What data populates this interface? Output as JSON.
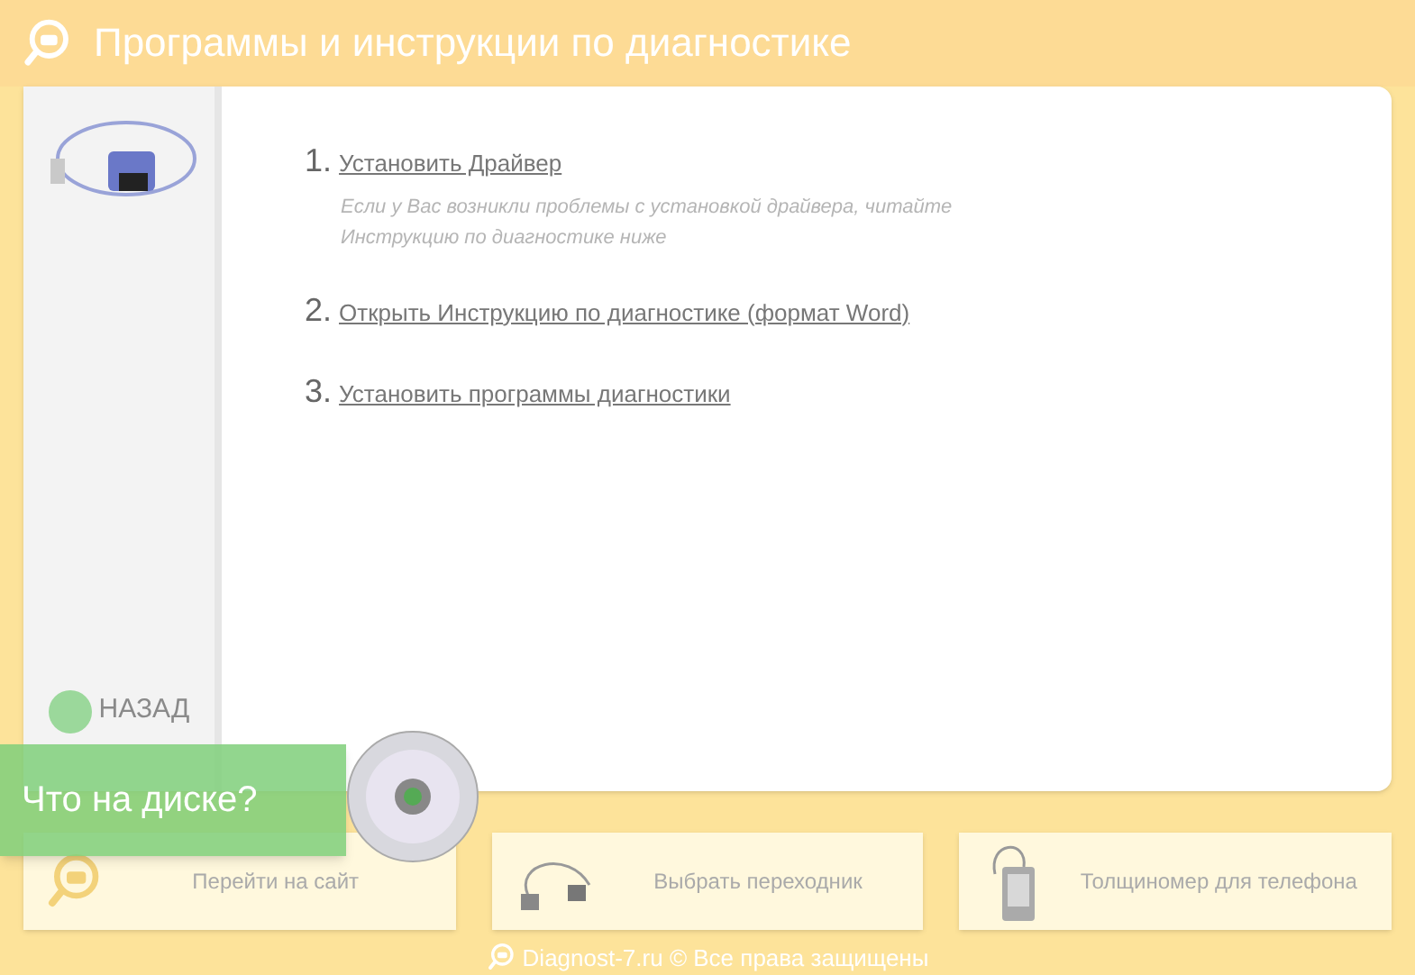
{
  "header": {
    "title": "Программы и инструкции по диагностике"
  },
  "steps": [
    {
      "number": "1.",
      "link": "Установить Драйвер",
      "note": "Если у Вас возникли проблемы с установкой драйвера, читайте Инструкцию по диагностике ниже"
    },
    {
      "number": "2.",
      "link": "Открыть Инструкцию по диагностике (формат Word)"
    },
    {
      "number": "3.",
      "link": "Установить программы диагностики"
    }
  ],
  "sidebar": {
    "back_button": "НАЗАД"
  },
  "banner": {
    "text": "Что на диске?"
  },
  "bottom_buttons": [
    {
      "kind": "site",
      "label": "Перейти на сайт"
    },
    {
      "kind": "adapter",
      "label": "Выбрать переходник"
    },
    {
      "kind": "gauge",
      "label": "Толщиномер для телефона"
    }
  ],
  "footer": {
    "text": "Diagnost-7.ru © Все права защищены"
  }
}
